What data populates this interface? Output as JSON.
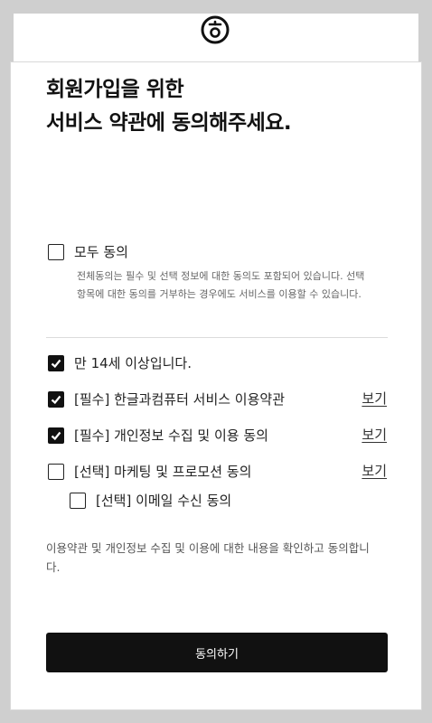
{
  "header": {
    "logo_icon": "hancom-logo-icon"
  },
  "title": {
    "line1": "회원가입을 위한",
    "line2": "서비스 약관에 동의해주세요."
  },
  "agree_all": {
    "label": "모두 동의",
    "checked": false,
    "description": "전체동의는 필수 및 선택 정보에 대한 동의도 포함되어 있습니다. 선택 항목에 대한 동의를 거부하는 경우에도 서비스를 이용할 수 있습니다."
  },
  "items": [
    {
      "label": "만 14세 이상입니다.",
      "checked": true,
      "view": ""
    },
    {
      "label": "[필수] 한글과컴퓨터 서비스 이용약관",
      "checked": true,
      "view": "보기"
    },
    {
      "label": "[필수] 개인정보 수집 및 이용 동의",
      "checked": true,
      "view": "보기"
    },
    {
      "label": "[선택] 마케팅 및 프로모션 동의",
      "checked": false,
      "view": "보기"
    },
    {
      "label": "[선택] 이메일 수신 동의",
      "checked": false,
      "view": ""
    }
  ],
  "notice": "이용약관 및 개인정보 수집 및 이용에 대한 내용을 확인하고 동의합니다.",
  "submit_label": "동의하기",
  "colors": {
    "primary": "#111111",
    "background": "#cfcfcf"
  }
}
